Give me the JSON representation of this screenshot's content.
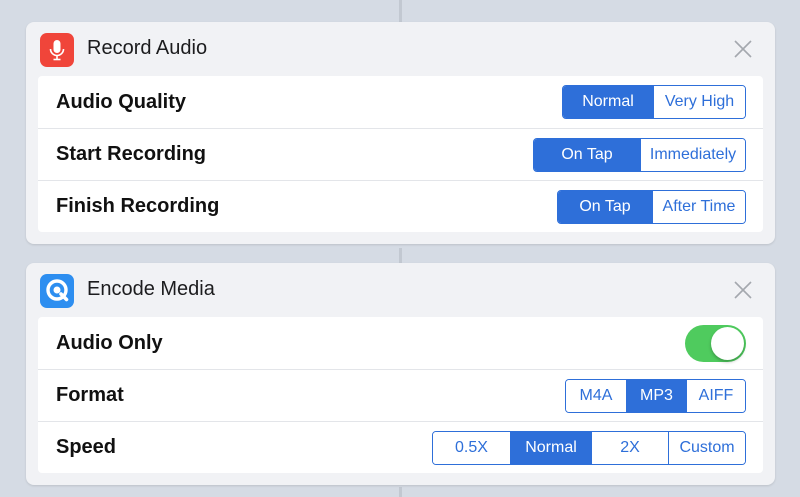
{
  "actions": [
    {
      "title": "Record Audio",
      "icon": "microphone-icon",
      "icon_color": "#f0453a",
      "rows": [
        {
          "label": "Audio Quality",
          "options": [
            "Normal",
            "Very High"
          ],
          "selected": "Normal"
        },
        {
          "label": "Start Recording",
          "options": [
            "On Tap",
            "Immediately"
          ],
          "selected": "On Tap"
        },
        {
          "label": "Finish Recording",
          "options": [
            "On Tap",
            "After Time"
          ],
          "selected": "On Tap"
        }
      ]
    },
    {
      "title": "Encode Media",
      "icon": "quicktime-icon",
      "icon_color": "#2d8ef0",
      "rows": [
        {
          "label": "Audio Only",
          "toggle": true
        },
        {
          "label": "Format",
          "options": [
            "M4A",
            "MP3",
            "AIFF"
          ],
          "selected": "MP3"
        },
        {
          "label": "Speed",
          "options": [
            "0.5X",
            "Normal",
            "2X",
            "Custom"
          ],
          "selected": "Normal"
        }
      ]
    }
  ],
  "colors": {
    "accent": "#2e6fd9",
    "toggle_on": "#4fcb5e",
    "background": "#d5dbe4"
  }
}
